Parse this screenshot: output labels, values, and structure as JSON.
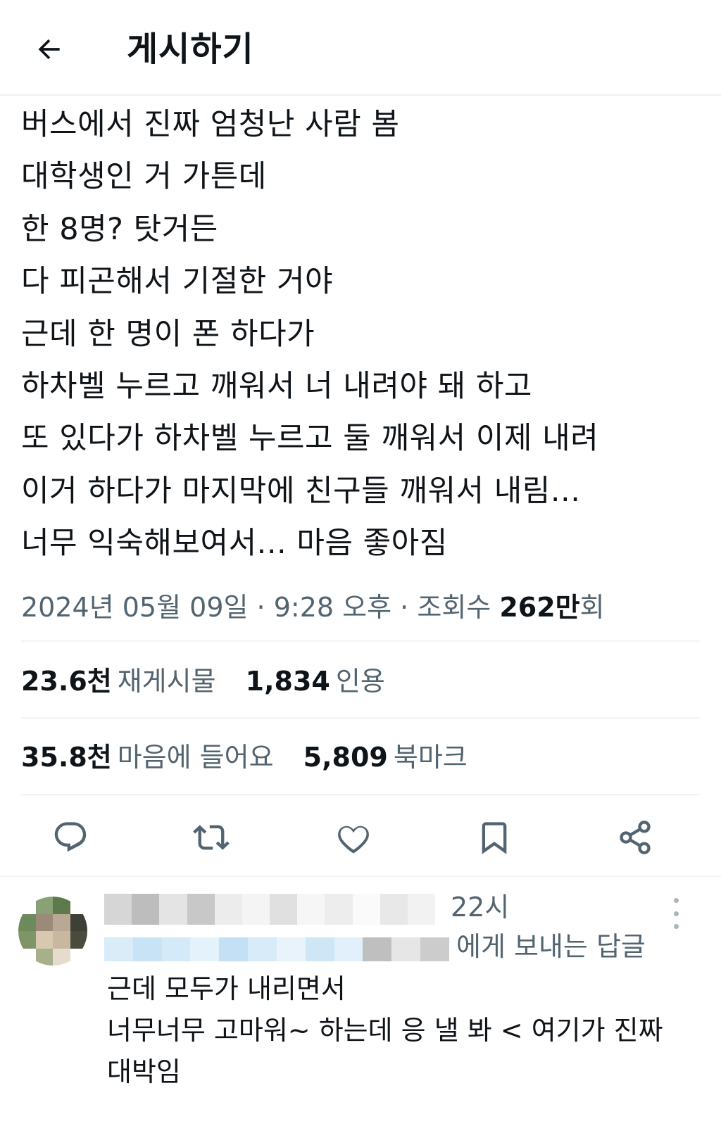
{
  "header": {
    "title": "게시하기"
  },
  "post": {
    "lines": [
      "버스에서 진짜 엄청난 사람 봄",
      "대학생인 거 가튼데",
      "한 8명? 탓거든",
      "다 피곤해서 기절한 거야",
      "근데 한 명이 폰 하다가",
      "하차벨 누르고 깨워서 너 내려야 돼 하고",
      "또 있다가 하차벨 누르고 둘 깨워서 이제 내려",
      "이거 하다가 마지막에 친구들 깨워서 내림...",
      "너무 익숙해보여서... 마음 좋아짐"
    ]
  },
  "meta": {
    "date": "2024년 05월 09일",
    "separator": "·",
    "time": "9:28 오후",
    "views_label": "조회수",
    "views_value": "262만",
    "views_unit": "회"
  },
  "stats": {
    "reposts": {
      "value": "23.6천",
      "label": "재게시물"
    },
    "quotes": {
      "value": "1,834",
      "label": "인용"
    },
    "likes": {
      "value": "35.8천",
      "label": "마음에 들어요"
    },
    "bookmarks": {
      "value": "5,809",
      "label": "북마크"
    }
  },
  "actions": [
    "reply-icon",
    "repost-icon",
    "heart-icon",
    "bookmark-icon",
    "share-icon"
  ],
  "reply": {
    "time": "22시",
    "reply_to": "에게 보내는 답글",
    "lines": [
      "근데 모두가 내리면서",
      "너무너무 고마워~ 하는데 응 낼 봐 < 여기가 진짜",
      "대박임"
    ]
  },
  "colors": {
    "text_primary": "#0f1419",
    "text_secondary": "#536471",
    "divider": "#eff3f4"
  }
}
